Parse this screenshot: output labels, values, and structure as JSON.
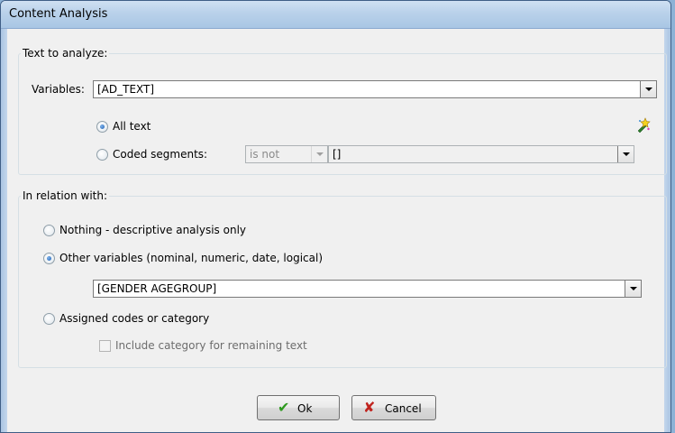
{
  "window": {
    "title": "Content Analysis"
  },
  "text_group": {
    "legend": "Text to analyze:",
    "variables_label": "Variables:",
    "variables_value": "[AD_TEXT]",
    "options": [
      {
        "label": "All text",
        "checked": true
      },
      {
        "label": "Coded segments:",
        "checked": false
      }
    ],
    "operator_value": "is not",
    "codes_value": "[]"
  },
  "relation_group": {
    "legend": "In relation with:",
    "options": [
      {
        "label": "Nothing - descriptive analysis only",
        "checked": false
      },
      {
        "label": "Other variables (nominal, numeric, date, logical)",
        "checked": true
      },
      {
        "label": "Assigned codes or category",
        "checked": false
      }
    ],
    "other_variables_value": "[GENDER AGEGROUP]",
    "include_category_label": "Include category for remaining text",
    "include_category_checked": false
  },
  "buttons": {
    "ok": "Ok",
    "cancel": "Cancel"
  },
  "icons": {
    "ok": "green-check-icon",
    "cancel": "red-x-icon",
    "wand": "magic-wand-icon"
  },
  "colors": {
    "ok_icon": "#2e9a1f",
    "cancel_icon": "#c0231e"
  }
}
